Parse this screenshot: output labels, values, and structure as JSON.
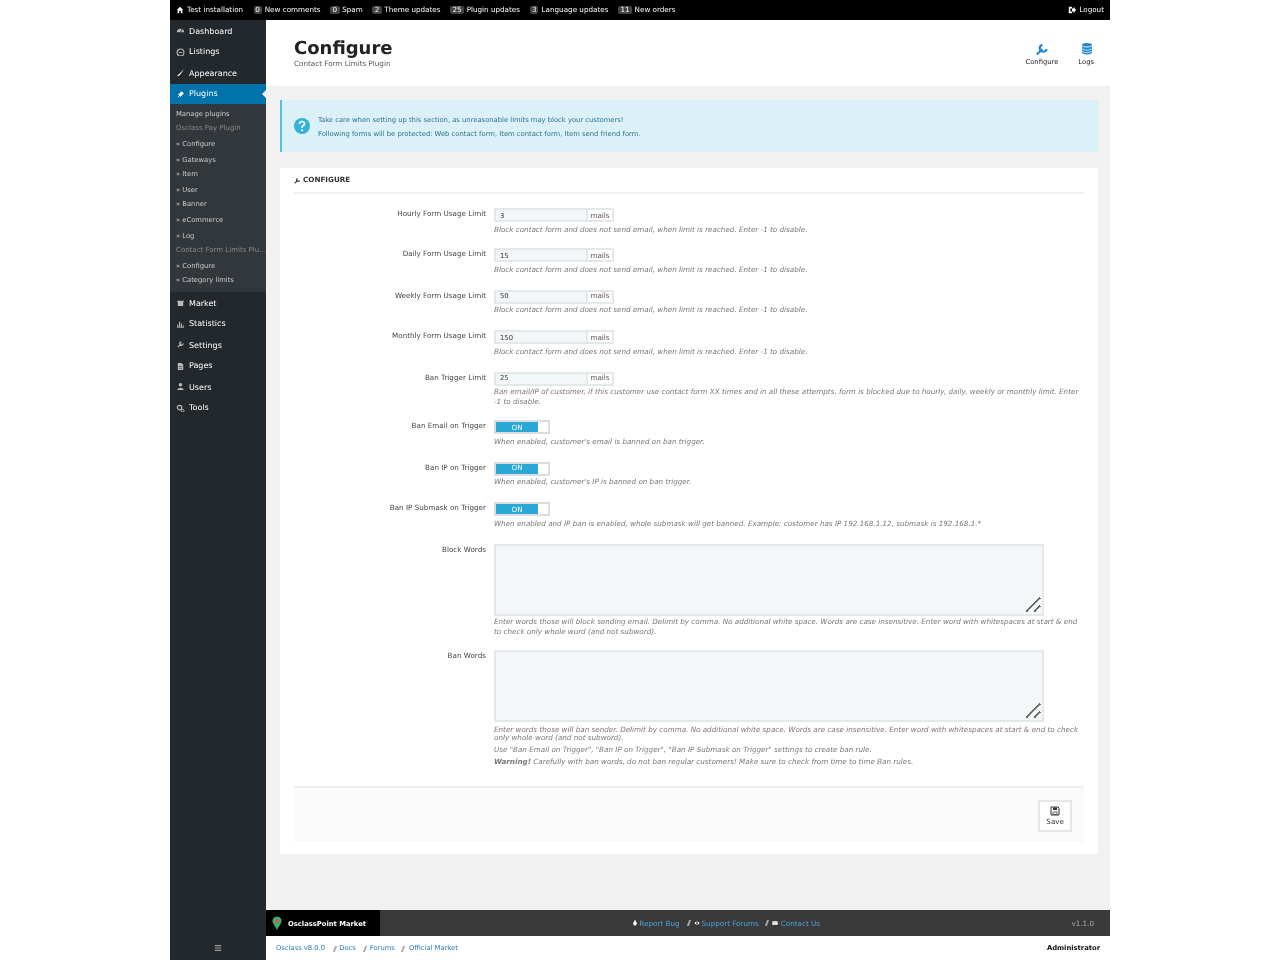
{
  "top_bar": {
    "site": "Test installation",
    "items": [
      {
        "count": "0",
        "label": "New comments"
      },
      {
        "count": "0",
        "label": "Spam"
      },
      {
        "count": "2",
        "label": "Theme updates"
      },
      {
        "count": "25",
        "label": "Plugin updates"
      },
      {
        "count": "3",
        "label": "Language updates"
      },
      {
        "count": "11",
        "label": "New orders"
      }
    ],
    "logout": "Logout"
  },
  "sidebar": {
    "items": [
      {
        "label": "Dashboard",
        "selected": false
      },
      {
        "label": "Listings",
        "selected": false
      },
      {
        "label": "Appearance",
        "selected": false
      },
      {
        "label": "Plugins",
        "selected": true,
        "children": [
          {
            "kind": "link",
            "label": "Manage plugins"
          },
          {
            "kind": "heading",
            "label": "Osclass Pay Plugin"
          },
          {
            "kind": "link",
            "label": "» Configure"
          },
          {
            "kind": "link",
            "label": "» Gateways"
          },
          {
            "kind": "link",
            "label": "» Item"
          },
          {
            "kind": "link",
            "label": "» User"
          },
          {
            "kind": "link",
            "label": "» Banner"
          },
          {
            "kind": "link",
            "label": "» eCommerce"
          },
          {
            "kind": "link",
            "label": "» Log"
          },
          {
            "kind": "heading",
            "label": "Contact Form Limits Plu..."
          },
          {
            "kind": "link",
            "label": "» Configure"
          },
          {
            "kind": "link",
            "label": "» Category limits"
          }
        ]
      },
      {
        "label": "Market",
        "selected": false
      },
      {
        "label": "Statistics",
        "selected": false
      },
      {
        "label": "Settings",
        "selected": false
      },
      {
        "label": "Pages",
        "selected": false
      },
      {
        "label": "Users",
        "selected": false
      },
      {
        "label": "Tools",
        "selected": false
      }
    ]
  },
  "header": {
    "title": "Configure",
    "subtitle": "Contact Form Limits Plugin",
    "actions": [
      {
        "label": "Configure"
      },
      {
        "label": "Logs"
      }
    ]
  },
  "notice": {
    "lines": [
      "Take care when setting up this section, as unreasonable limits may block your customers!",
      "Following forms will be protected: Web contact form, Item contact form, Item send friend form."
    ]
  },
  "panel": {
    "title": "CONFIGURE",
    "fields": [
      {
        "kind": "number",
        "label": "Hourly Form Usage Limit",
        "value": "3",
        "unit": "mails",
        "help": [
          "Block contact form and does not send email, when limit is reached. Enter -1 to disable."
        ]
      },
      {
        "kind": "number",
        "label": "Daily Form Usage Limit",
        "value": "15",
        "unit": "mails",
        "help": [
          "Block contact form and does not send email, when limit is reached. Enter -1 to disable."
        ]
      },
      {
        "kind": "number",
        "label": "Weekly Form Usage Limit",
        "value": "50",
        "unit": "mails",
        "help": [
          "Block contact form and does not send email, when limit is reached. Enter -1 to disable."
        ]
      },
      {
        "kind": "number",
        "label": "Monthly Form Usage Limit",
        "value": "150",
        "unit": "mails",
        "help": [
          "Block contact form and does not send email, when limit is reached. Enter -1 to disable."
        ]
      },
      {
        "kind": "number",
        "label": "Ban Trigger Limit",
        "value": "25",
        "unit": "mails",
        "help": [
          "Ban email/IP of customer, if this customer use contact form XX times and in all these attempts, form is blocked due to hourly, daily, weekly or monthly limit. Enter -1 to disable."
        ]
      },
      {
        "kind": "toggle",
        "label": "Ban Email on Trigger",
        "on": true,
        "state_text": "ON",
        "help": [
          "When enabled, customer's email is banned on ban trigger."
        ]
      },
      {
        "kind": "toggle",
        "label": "Ban IP on Trigger",
        "on": true,
        "state_text": "ON",
        "help": [
          "When enabled, customer's IP is banned on ban trigger."
        ]
      },
      {
        "kind": "toggle",
        "label": "Ban IP Submask on Trigger",
        "on": true,
        "state_text": "ON",
        "help": [
          "When enabled and IP ban is enabled, whole submask will get banned. Example: customer has IP 192.168.1.12, submask is 192.168.1.*"
        ]
      },
      {
        "kind": "textarea",
        "label": "Block Words",
        "help": [
          "Enter words those will block sending email. Delimit by comma. No additional white space. Words are case insensitive. Enter word with whitespaces at start & end to check only whole word (and not subword)."
        ]
      },
      {
        "kind": "textarea",
        "label": "Ban Words",
        "help": [
          "Enter words those will ban sender. Delimit by comma. No additional white space. Words are case insensitive. Enter word with whitespaces at start & end to check only whole word (and not subword).",
          "Use \"Ban Email on Trigger\", \"Ban IP on Trigger\", \"Ban IP Submask on Trigger\" settings to create ban rule.",
          "**Warning!** Carefully with ban words, do not ban regular customers! Make sure to check from time to time Ban rules."
        ]
      }
    ],
    "save": "Save"
  },
  "footer": {
    "brand": "OsclassPoint Market",
    "links": [
      "Report Bug",
      "Support Forums",
      "Contact Us"
    ],
    "version": "v1.1.0"
  },
  "breadcrumbs": [
    "Osclass v8.0.0",
    "Docs",
    "Forums",
    "Official Market"
  ],
  "user": "Administrator"
}
